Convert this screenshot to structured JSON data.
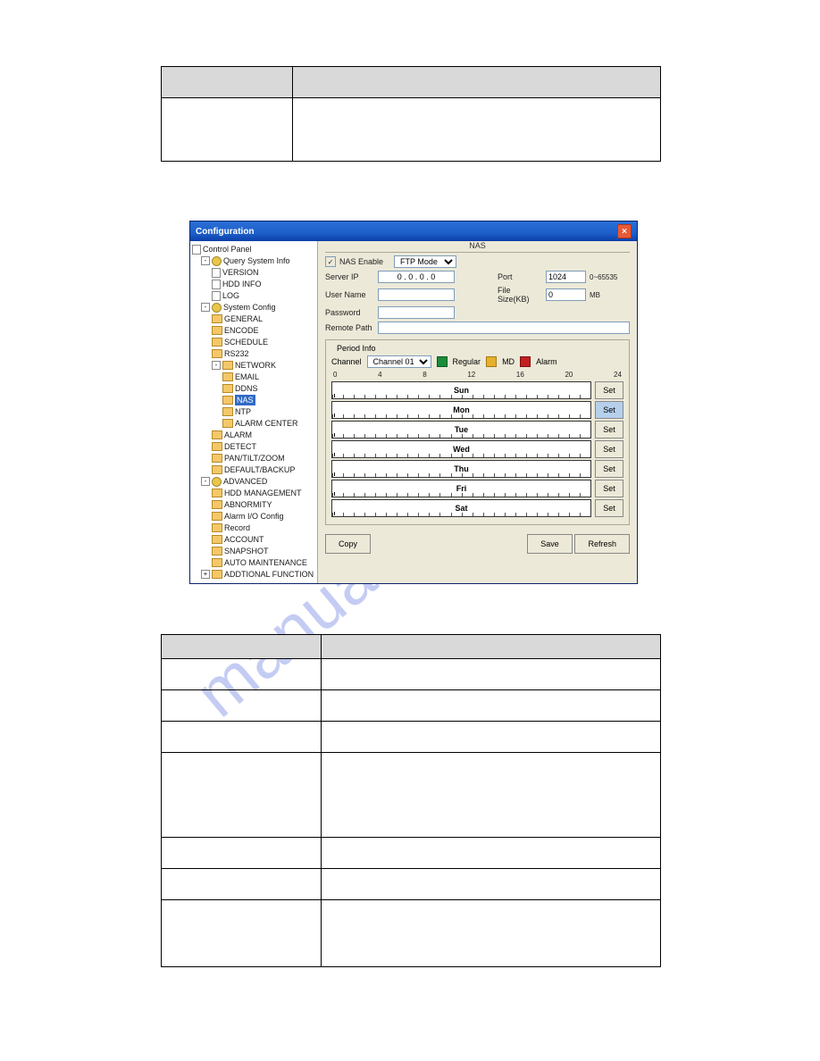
{
  "watermark": "manualshive.com",
  "table1": {
    "col1_header": "",
    "col2_header": "",
    "row1_col1": "",
    "row1_col2": ""
  },
  "window": {
    "title": "Configuration",
    "tree": {
      "root": "Control Panel",
      "items": [
        {
          "lvl": 1,
          "icon": "gear",
          "label": "Query System Info",
          "expand": "-"
        },
        {
          "lvl": 2,
          "icon": "pg",
          "label": "VERSION"
        },
        {
          "lvl": 2,
          "icon": "pg",
          "label": "HDD INFO"
        },
        {
          "lvl": 2,
          "icon": "pg",
          "label": "LOG"
        },
        {
          "lvl": 1,
          "icon": "gear",
          "label": "System Config",
          "expand": "-"
        },
        {
          "lvl": 2,
          "icon": "fld",
          "label": "GENERAL"
        },
        {
          "lvl": 2,
          "icon": "fld",
          "label": "ENCODE"
        },
        {
          "lvl": 2,
          "icon": "fld",
          "label": "SCHEDULE"
        },
        {
          "lvl": 2,
          "icon": "fld",
          "label": "RS232"
        },
        {
          "lvl": 2,
          "icon": "fld",
          "label": "NETWORK",
          "expand": "-"
        },
        {
          "lvl": 3,
          "icon": "fld",
          "label": "EMAIL"
        },
        {
          "lvl": 3,
          "icon": "fld",
          "label": "DDNS"
        },
        {
          "lvl": 3,
          "icon": "fld",
          "label": "NAS",
          "selected": true
        },
        {
          "lvl": 3,
          "icon": "fld",
          "label": "NTP"
        },
        {
          "lvl": 3,
          "icon": "fld",
          "label": "ALARM CENTER"
        },
        {
          "lvl": 2,
          "icon": "fld",
          "label": "ALARM"
        },
        {
          "lvl": 2,
          "icon": "fld",
          "label": "DETECT"
        },
        {
          "lvl": 2,
          "icon": "fld",
          "label": "PAN/TILT/ZOOM"
        },
        {
          "lvl": 2,
          "icon": "fld",
          "label": "DEFAULT/BACKUP"
        },
        {
          "lvl": 1,
          "icon": "gear",
          "label": "ADVANCED",
          "expand": "-"
        },
        {
          "lvl": 2,
          "icon": "fld",
          "label": "HDD MANAGEMENT"
        },
        {
          "lvl": 2,
          "icon": "fld",
          "label": "ABNORMITY"
        },
        {
          "lvl": 2,
          "icon": "fld",
          "label": "Alarm I/O Config"
        },
        {
          "lvl": 2,
          "icon": "fld",
          "label": "Record"
        },
        {
          "lvl": 2,
          "icon": "fld",
          "label": "ACCOUNT"
        },
        {
          "lvl": 2,
          "icon": "fld",
          "label": "SNAPSHOT"
        },
        {
          "lvl": 2,
          "icon": "fld",
          "label": "AUTO MAINTENANCE"
        },
        {
          "lvl": 1,
          "icon": "fld",
          "label": "ADDTIONAL FUNCTION",
          "expand": "+"
        }
      ]
    },
    "section_title": "NAS",
    "form": {
      "nas_enable_label": "NAS Enable",
      "nas_enable_checked": "✓",
      "mode_value": "FTP Mode",
      "server_ip_label": "Server IP",
      "server_ip_value": "0 . 0 . 0 . 0",
      "port_label": "Port",
      "port_value": "1024",
      "port_range": "0~65535",
      "user_name_label": "User Name",
      "user_name_value": "",
      "file_size_label": "File Size(KB)",
      "file_size_value": "0",
      "file_size_unit": "MB",
      "password_label": "Password",
      "password_value": "",
      "remote_path_label": "Remote Path",
      "remote_path_value": ""
    },
    "period": {
      "group_label": "Period Info",
      "channel_label": "Channel",
      "channel_value": "Channel 01",
      "legend_regular": "Regular",
      "legend_md": "MD",
      "legend_alarm": "Alarm",
      "scale": [
        "0",
        "4",
        "8",
        "12",
        "16",
        "20",
        "24"
      ],
      "days": [
        "Sun",
        "Mon",
        "Tue",
        "Wed",
        "Thu",
        "Fri",
        "Sat"
      ],
      "set_label": "Set"
    },
    "buttons": {
      "copy": "Copy",
      "save": "Save",
      "refresh": "Refresh"
    }
  },
  "table2": {
    "rows": 8
  }
}
